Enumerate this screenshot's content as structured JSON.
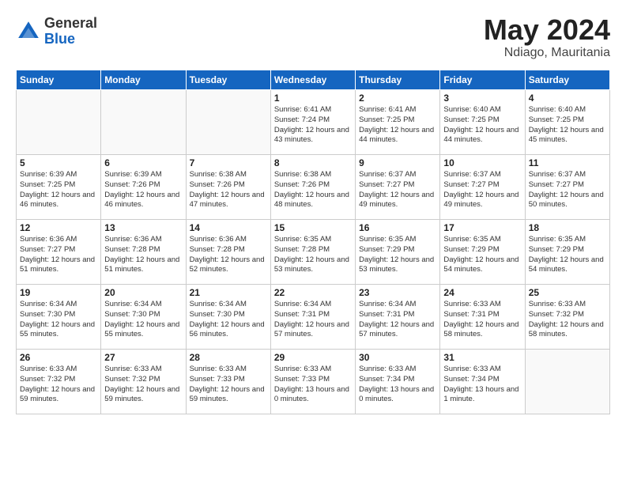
{
  "header": {
    "logo_general": "General",
    "logo_blue": "Blue",
    "month_title": "May 2024",
    "location": "Ndiago, Mauritania"
  },
  "weekdays": [
    "Sunday",
    "Monday",
    "Tuesday",
    "Wednesday",
    "Thursday",
    "Friday",
    "Saturday"
  ],
  "days": [
    {
      "date": "",
      "info": ""
    },
    {
      "date": "",
      "info": ""
    },
    {
      "date": "",
      "info": ""
    },
    {
      "date": "1",
      "info": "Sunrise: 6:41 AM\nSunset: 7:24 PM\nDaylight: 12 hours\nand 43 minutes."
    },
    {
      "date": "2",
      "info": "Sunrise: 6:41 AM\nSunset: 7:25 PM\nDaylight: 12 hours\nand 44 minutes."
    },
    {
      "date": "3",
      "info": "Sunrise: 6:40 AM\nSunset: 7:25 PM\nDaylight: 12 hours\nand 44 minutes."
    },
    {
      "date": "4",
      "info": "Sunrise: 6:40 AM\nSunset: 7:25 PM\nDaylight: 12 hours\nand 45 minutes."
    },
    {
      "date": "5",
      "info": "Sunrise: 6:39 AM\nSunset: 7:25 PM\nDaylight: 12 hours\nand 46 minutes."
    },
    {
      "date": "6",
      "info": "Sunrise: 6:39 AM\nSunset: 7:26 PM\nDaylight: 12 hours\nand 46 minutes."
    },
    {
      "date": "7",
      "info": "Sunrise: 6:38 AM\nSunset: 7:26 PM\nDaylight: 12 hours\nand 47 minutes."
    },
    {
      "date": "8",
      "info": "Sunrise: 6:38 AM\nSunset: 7:26 PM\nDaylight: 12 hours\nand 48 minutes."
    },
    {
      "date": "9",
      "info": "Sunrise: 6:37 AM\nSunset: 7:27 PM\nDaylight: 12 hours\nand 49 minutes."
    },
    {
      "date": "10",
      "info": "Sunrise: 6:37 AM\nSunset: 7:27 PM\nDaylight: 12 hours\nand 49 minutes."
    },
    {
      "date": "11",
      "info": "Sunrise: 6:37 AM\nSunset: 7:27 PM\nDaylight: 12 hours\nand 50 minutes."
    },
    {
      "date": "12",
      "info": "Sunrise: 6:36 AM\nSunset: 7:27 PM\nDaylight: 12 hours\nand 51 minutes."
    },
    {
      "date": "13",
      "info": "Sunrise: 6:36 AM\nSunset: 7:28 PM\nDaylight: 12 hours\nand 51 minutes."
    },
    {
      "date": "14",
      "info": "Sunrise: 6:36 AM\nSunset: 7:28 PM\nDaylight: 12 hours\nand 52 minutes."
    },
    {
      "date": "15",
      "info": "Sunrise: 6:35 AM\nSunset: 7:28 PM\nDaylight: 12 hours\nand 53 minutes."
    },
    {
      "date": "16",
      "info": "Sunrise: 6:35 AM\nSunset: 7:29 PM\nDaylight: 12 hours\nand 53 minutes."
    },
    {
      "date": "17",
      "info": "Sunrise: 6:35 AM\nSunset: 7:29 PM\nDaylight: 12 hours\nand 54 minutes."
    },
    {
      "date": "18",
      "info": "Sunrise: 6:35 AM\nSunset: 7:29 PM\nDaylight: 12 hours\nand 54 minutes."
    },
    {
      "date": "19",
      "info": "Sunrise: 6:34 AM\nSunset: 7:30 PM\nDaylight: 12 hours\nand 55 minutes."
    },
    {
      "date": "20",
      "info": "Sunrise: 6:34 AM\nSunset: 7:30 PM\nDaylight: 12 hours\nand 55 minutes."
    },
    {
      "date": "21",
      "info": "Sunrise: 6:34 AM\nSunset: 7:30 PM\nDaylight: 12 hours\nand 56 minutes."
    },
    {
      "date": "22",
      "info": "Sunrise: 6:34 AM\nSunset: 7:31 PM\nDaylight: 12 hours\nand 57 minutes."
    },
    {
      "date": "23",
      "info": "Sunrise: 6:34 AM\nSunset: 7:31 PM\nDaylight: 12 hours\nand 57 minutes."
    },
    {
      "date": "24",
      "info": "Sunrise: 6:33 AM\nSunset: 7:31 PM\nDaylight: 12 hours\nand 58 minutes."
    },
    {
      "date": "25",
      "info": "Sunrise: 6:33 AM\nSunset: 7:32 PM\nDaylight: 12 hours\nand 58 minutes."
    },
    {
      "date": "26",
      "info": "Sunrise: 6:33 AM\nSunset: 7:32 PM\nDaylight: 12 hours\nand 59 minutes."
    },
    {
      "date": "27",
      "info": "Sunrise: 6:33 AM\nSunset: 7:32 PM\nDaylight: 12 hours\nand 59 minutes."
    },
    {
      "date": "28",
      "info": "Sunrise: 6:33 AM\nSunset: 7:33 PM\nDaylight: 12 hours\nand 59 minutes."
    },
    {
      "date": "29",
      "info": "Sunrise: 6:33 AM\nSunset: 7:33 PM\nDaylight: 13 hours\nand 0 minutes."
    },
    {
      "date": "30",
      "info": "Sunrise: 6:33 AM\nSunset: 7:34 PM\nDaylight: 13 hours\nand 0 minutes."
    },
    {
      "date": "31",
      "info": "Sunrise: 6:33 AM\nSunset: 7:34 PM\nDaylight: 13 hours\nand 1 minute."
    },
    {
      "date": "",
      "info": ""
    }
  ]
}
